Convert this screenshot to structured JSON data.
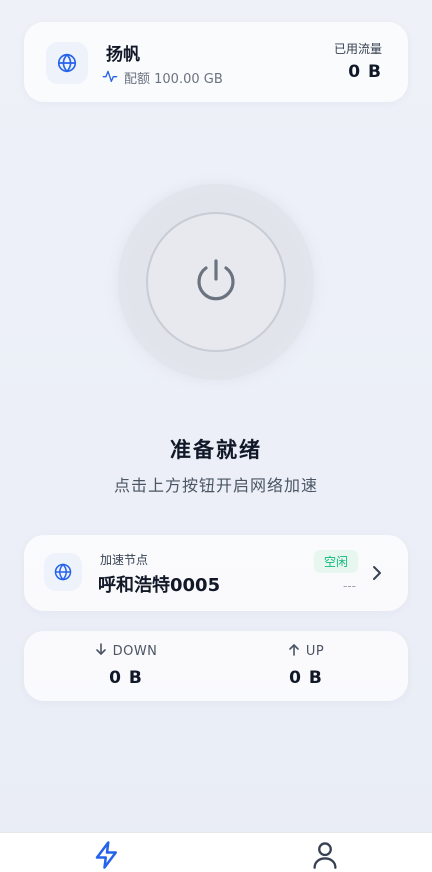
{
  "plan": {
    "name": "扬帆",
    "quota_text": "配额 100.00 GB",
    "used_label": "已用流量",
    "used_value": "0 B",
    "globe_icon": "globe-icon",
    "activity_icon": "activity-icon"
  },
  "power": {
    "icon": "power-icon",
    "status_title": "准备就绪",
    "status_subtitle": "点击上方按钮开启网络加速"
  },
  "node": {
    "label": "加速节点",
    "name": "呼和浩特0005",
    "status": "空闲",
    "latency": "---",
    "chevron_icon": "chevron-right-icon"
  },
  "traffic": {
    "down_label": "DOWN",
    "down_value": "0 B",
    "up_label": "UP",
    "up_value": "0 B"
  },
  "nav": {
    "home_icon": "lightning-icon",
    "profile_icon": "user-icon"
  },
  "colors": {
    "accent": "#2563eb",
    "success": "#10b981",
    "background": "#eef1f8"
  }
}
